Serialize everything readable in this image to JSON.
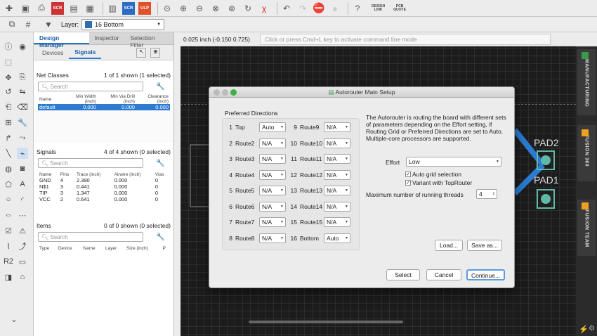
{
  "toolbar": {
    "design_link": "DESIGN\nLINK",
    "pcb_quote": "PCB\nQUOTE",
    "scr": "SCR",
    "ulp": "ULP"
  },
  "layerbar": {
    "label": "Layer:",
    "value": "16 Bottom",
    "color": "#2f6db2"
  },
  "panel": {
    "tabs": [
      "Design Manager",
      "Inspector",
      "Selection Filter"
    ],
    "subtabs": [
      "Devices",
      "Signals"
    ],
    "net_classes": {
      "title": "Net Classes",
      "count": "1 of 1 shown (1 selected)",
      "search": "Search",
      "headers": [
        "Name",
        "Min Width\n(inch)",
        "Min Via Drill\n(inch)",
        "Clearance\n(inch)"
      ],
      "rows": [
        [
          "default",
          "0.000",
          "0.000",
          "0.000"
        ]
      ]
    },
    "signals": {
      "title": "Signals",
      "count": "4 of 4 shown (0 selected)",
      "search": "Search",
      "headers": [
        "Name",
        "Pins",
        "Trace (inch)",
        "Airwire (inch)",
        "Vias"
      ],
      "rows": [
        [
          "GND",
          "4",
          "2.390",
          "0.000",
          "0"
        ],
        [
          "N$1",
          "3",
          "0.441",
          "0.000",
          "0"
        ],
        [
          "TIP",
          "3",
          "1.347",
          "0.000",
          "0"
        ],
        [
          "VCC",
          "2",
          "0.641",
          "0.000",
          "0"
        ]
      ]
    },
    "items": {
      "title": "Items",
      "count": "0 of 0 shown (0 selected)",
      "search": "Search",
      "headers": [
        "Type",
        "Device",
        "Name",
        "Layer",
        "Size (inch)",
        "P"
      ]
    }
  },
  "coord": "0.025 inch (-0.150 0.725)",
  "command_placeholder": "Click or press Cmd+L key to activate command line mode",
  "right_tabs": [
    "MANUFACTURING",
    "FUSION 360",
    "FUSION TEAM"
  ],
  "canvas_labels": {
    "pad2": "PAD2",
    "pad1": "PAD1"
  },
  "dialog": {
    "title": "Autorouter Main Setup",
    "group_title": "Preferred Directions",
    "left_dirs": [
      [
        "1",
        "Top",
        "Auto"
      ],
      [
        "2",
        "Route2",
        "N/A"
      ],
      [
        "3",
        "Route3",
        "N/A"
      ],
      [
        "4",
        "Route4",
        "N/A"
      ],
      [
        "5",
        "Route5",
        "N/A"
      ],
      [
        "6",
        "Route6",
        "N/A"
      ],
      [
        "7",
        "Route7",
        "N/A"
      ],
      [
        "8",
        "Route8",
        "N/A"
      ]
    ],
    "right_dirs": [
      [
        "9",
        "Route9",
        "N/A"
      ],
      [
        "10",
        "Route10",
        "N/A"
      ],
      [
        "11",
        "Route11",
        "N/A"
      ],
      [
        "12",
        "Route12",
        "N/A"
      ],
      [
        "13",
        "Route13",
        "N/A"
      ],
      [
        "14",
        "Route14",
        "N/A"
      ],
      [
        "15",
        "Route15",
        "N/A"
      ],
      [
        "16",
        "Bottom",
        "Auto"
      ]
    ],
    "description": "The Autorouter is routing the board with different sets of parameters depending on the Effort setting, if Routing Grid or Preferred Directions are set to Auto. Multiple-core processors are supported.",
    "effort_label": "Effort",
    "effort_value": "Low",
    "auto_grid": "Auto grid selection",
    "variant": "Variant with TopRouter",
    "threads_label": "Maximum number of running threads",
    "threads_value": "4",
    "load": "Load...",
    "save": "Save as...",
    "select": "Select",
    "cancel": "Cancel",
    "continue": "Continue..."
  }
}
